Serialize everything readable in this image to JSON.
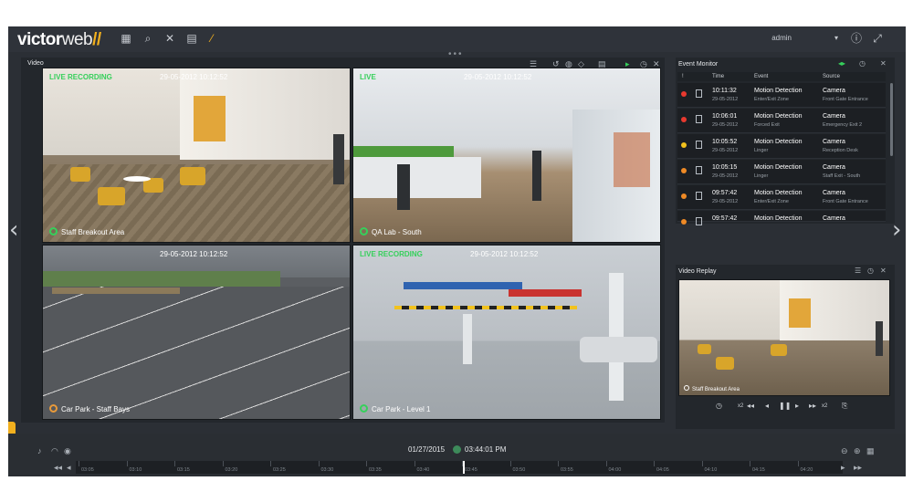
{
  "app": {
    "logo_main": "victor",
    "logo_web": "web",
    "logo_mark": "//",
    "user": "admin"
  },
  "video_panel": {
    "title": "Video",
    "cameras": [
      {
        "status": "LIVE  RECORDING",
        "timestamp": "29-05-2012  10:12:52",
        "name": "Staff Breakout Area",
        "dot_color": "#36d05b"
      },
      {
        "status": "LIVE",
        "timestamp": "29-05-2012  10:12:52",
        "name": "QA Lab - South",
        "dot_color": "#36d05b"
      },
      {
        "status": "",
        "timestamp": "29-05-2012  10:12:52",
        "name": "Car Park - Staff Bays",
        "dot_color": "#e89a3a"
      },
      {
        "status": "LIVE  RECORDING",
        "timestamp": "29-05-2012  10:12:52",
        "name": "Car Park - Level 1",
        "dot_color": "#36d05b"
      }
    ]
  },
  "event_monitor": {
    "title": "Event Monitor",
    "columns": {
      "severity": "!",
      "time": "Time",
      "event": "Event",
      "source": "Source"
    },
    "rows": [
      {
        "time": "10:11:32",
        "date": "29-05-2012",
        "event": "Motion Detection",
        "event_sub": "Enter/Exit Zone",
        "source": "Camera",
        "source_sub": "Front Gate Entrance",
        "color": "#e8392f"
      },
      {
        "time": "10:06:01",
        "date": "29-05-2012",
        "event": "Motion Detection",
        "event_sub": "Forced Exit",
        "source": "Camera",
        "source_sub": "Emergency Exit 2",
        "color": "#e8392f"
      },
      {
        "time": "10:05:52",
        "date": "29-05-2012",
        "event": "Motion Detection",
        "event_sub": "Linger",
        "source": "Camera",
        "source_sub": "Reception Desk",
        "color": "#f2c21d"
      },
      {
        "time": "10:05:15",
        "date": "29-05-2012",
        "event": "Motion Detection",
        "event_sub": "Linger",
        "source": "Camera",
        "source_sub": "Staff Exit - South",
        "color": "#ef8a25"
      },
      {
        "time": "09:57:42",
        "date": "29-05-2012",
        "event": "Motion Detection",
        "event_sub": "Enter/Exit Zone",
        "source": "Camera",
        "source_sub": "Front Gate Entrance",
        "color": "#ef8a25"
      },
      {
        "time": "09:57:42",
        "date": "",
        "event": "Motion Detection",
        "event_sub": "",
        "source": "Camera",
        "source_sub": "",
        "color": "#ef8a25"
      }
    ]
  },
  "video_replay": {
    "title": "Video Replay",
    "camera_name": "Staff Breakout Area",
    "speed_back": "x2",
    "speed_fwd": "x2"
  },
  "timeline": {
    "date": "01/27/2015",
    "time": "03:44:01 PM",
    "ticks": [
      "03:05",
      "03:10",
      "03:15",
      "03:20",
      "03:25",
      "03:30",
      "03:35",
      "03:40",
      "03:45",
      "03:50",
      "03:55",
      "04:00",
      "04:05",
      "04:10",
      "04:15",
      "04:20"
    ]
  },
  "colors": {
    "live": "#36d05b",
    "accent": "#f2b01e",
    "panel": "#23272c"
  }
}
